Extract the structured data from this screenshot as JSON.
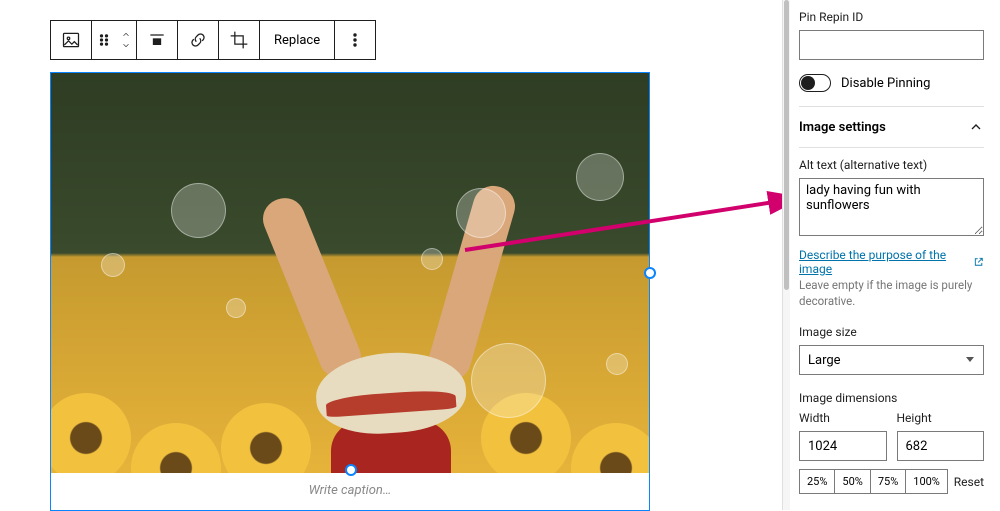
{
  "toolbar": {
    "replace_label": "Replace"
  },
  "caption_placeholder": "Write caption…",
  "sidebar": {
    "pin_repin_label": "Pin Repin ID",
    "pin_repin_value": "",
    "disable_pinning_label": "Disable Pinning",
    "section_title": "Image settings",
    "alt_label": "Alt text (alternative text)",
    "alt_value": "lady having fun with sunflowers",
    "describe_link": "Describe the purpose of the image",
    "alt_helper": "Leave empty if the image is purely decorative.",
    "size_label": "Image size",
    "size_value": "Large",
    "dimensions_label": "Image dimensions",
    "width_label": "Width",
    "width_value": "1024",
    "height_label": "Height",
    "height_value": "682",
    "pct": [
      "25%",
      "50%",
      "75%",
      "100%"
    ],
    "reset_label": "Reset"
  },
  "colors": {
    "annotation": "#d1006c"
  }
}
